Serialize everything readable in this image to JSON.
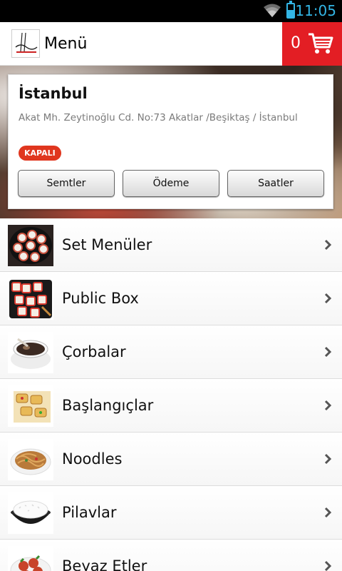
{
  "status_bar": {
    "time": "11:05",
    "icons": [
      "wifi-icon",
      "battery-icon"
    ],
    "accent_color": "#33b5e5"
  },
  "action_bar": {
    "title": "Menü",
    "logo": "public-logo-icon",
    "cart_count": "0",
    "cart_icon": "cart-icon",
    "cart_color": "#e31e24"
  },
  "location": {
    "city": "İstanbul",
    "address": "Akat Mh. Zeytinoğlu Cd. No:73  Akatlar /Beşiktaş / İstanbul",
    "status": "KAPALI",
    "status_color": "#e0361e",
    "buttons": [
      "Semtler",
      "Ödeme",
      "Saatler"
    ]
  },
  "menu": {
    "items": [
      {
        "label": "Set Menüler",
        "icon": "sushi-set-image"
      },
      {
        "label": "Public Box",
        "icon": "public-box-image"
      },
      {
        "label": "Çorbalar",
        "icon": "soup-image"
      },
      {
        "label": "Başlangıçlar",
        "icon": "starters-image"
      },
      {
        "label": "Noodles",
        "icon": "noodles-image"
      },
      {
        "label": "Pilavlar",
        "icon": "rice-image"
      },
      {
        "label": "Beyaz Etler",
        "icon": "white-meat-image"
      }
    ]
  }
}
